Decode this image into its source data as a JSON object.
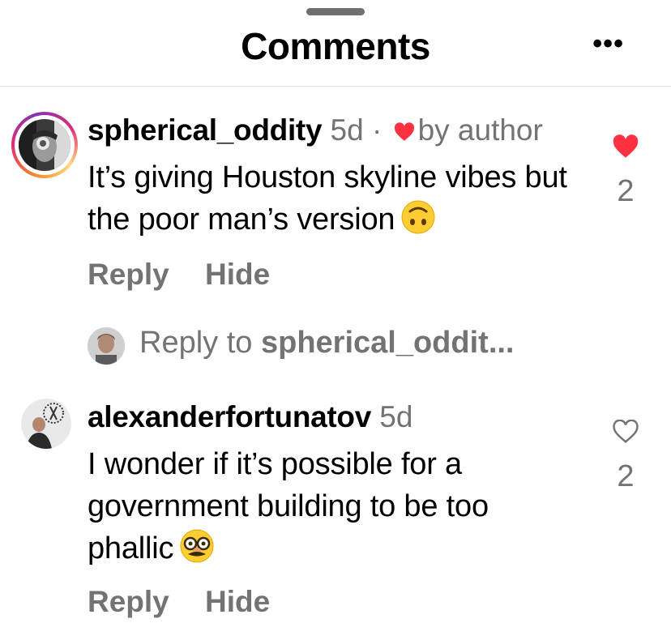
{
  "header": {
    "title": "Comments",
    "more_label": "•••"
  },
  "comments": [
    {
      "username": "spherical_oddity",
      "time": "5d",
      "separator": "·",
      "author_badge": "by author",
      "text": "It’s giving Houston skyline vibes but the poor man’s version",
      "emoji": "upside-down-face",
      "reply_label": "Reply",
      "hide_label": "Hide",
      "likes": "2",
      "liked": true
    },
    {
      "username": "alexanderfortunatov",
      "time": "5d",
      "text": "I wonder if it’s possible for a government building to be too phallic",
      "emoji": "disguised-face",
      "reply_label": "Reply",
      "hide_label": "Hide",
      "likes": "2",
      "liked": false
    }
  ],
  "reply_compose": {
    "prefix": "Reply to",
    "target": "spherical_oddit..."
  },
  "colors": {
    "like_red": "#ff3040",
    "secondary_text": "#737373"
  }
}
